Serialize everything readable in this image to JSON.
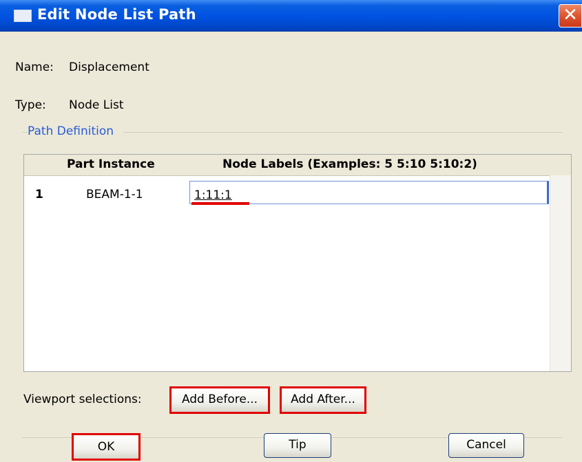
{
  "window": {
    "title": "Edit Node List Path",
    "close_glyph": "✕"
  },
  "name_row": {
    "label": "Name:",
    "value": "Displacement"
  },
  "type_row": {
    "label": "Type:",
    "value": "Node List"
  },
  "path_definition": {
    "legend": "Path Definition",
    "columns": [
      "Part Instance",
      "Node Labels (Examples: 5 5:10 5:10:2)"
    ],
    "rows": [
      {
        "index": "1",
        "part_instance": "BEAM-1-1",
        "node_labels": "1:11:1"
      }
    ]
  },
  "viewport": {
    "label": "Viewport selections:",
    "add_before": "Add Before...",
    "add_after": "Add After..."
  },
  "buttons": {
    "ok": "OK",
    "tip": "Tip",
    "cancel": "Cancel"
  },
  "colors": {
    "title_bar": "#0053e1",
    "highlight": "#e00000",
    "legend": "#2a5bd7",
    "dialog_bg": "#ece9d8"
  }
}
